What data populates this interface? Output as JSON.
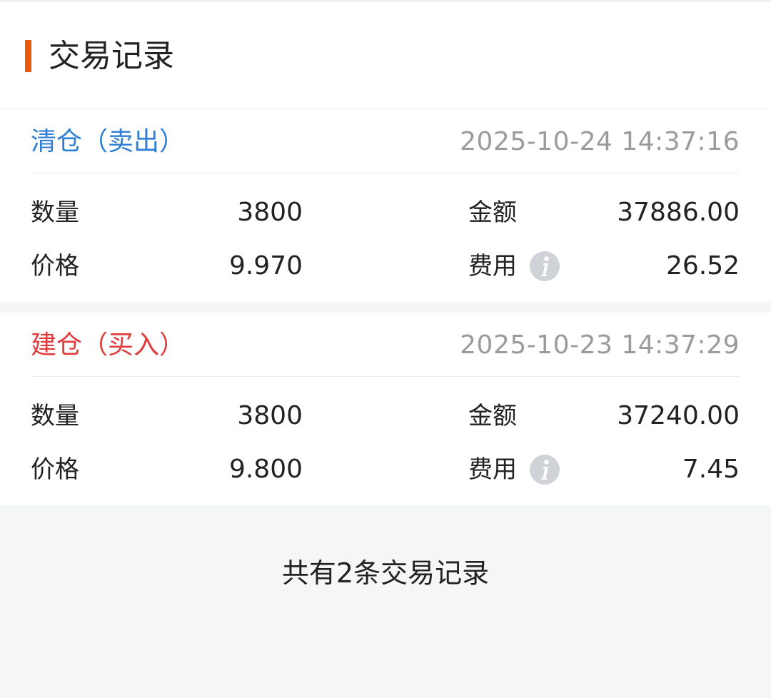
{
  "colors": {
    "accent": "#e8590c",
    "sell": "#2f7fd6",
    "buy": "#e23b3b",
    "muted": "#9b9b9b",
    "info_icon": "#cfd3d8"
  },
  "header": {
    "title": "交易记录"
  },
  "records": [
    {
      "type_label": "清仓（卖出）",
      "type_color": "#2f7fd6",
      "time": "2025-10-24 14:37:16",
      "quantity_label": "数量",
      "quantity": "3800",
      "amount_label": "金额",
      "amount": "37886.00",
      "price_label": "价格",
      "price": "9.970",
      "fee_label": "费用",
      "fee": "26.52",
      "fee_icon": "info-icon"
    },
    {
      "type_label": "建仓（买入）",
      "type_color": "#e23b3b",
      "time": "2025-10-23 14:37:29",
      "quantity_label": "数量",
      "quantity": "3800",
      "amount_label": "金额",
      "amount": "37240.00",
      "price_label": "价格",
      "price": "9.800",
      "fee_label": "费用",
      "fee": "7.45",
      "fee_icon": "info-icon"
    }
  ],
  "footer": {
    "summary": "共有2条交易记录"
  }
}
